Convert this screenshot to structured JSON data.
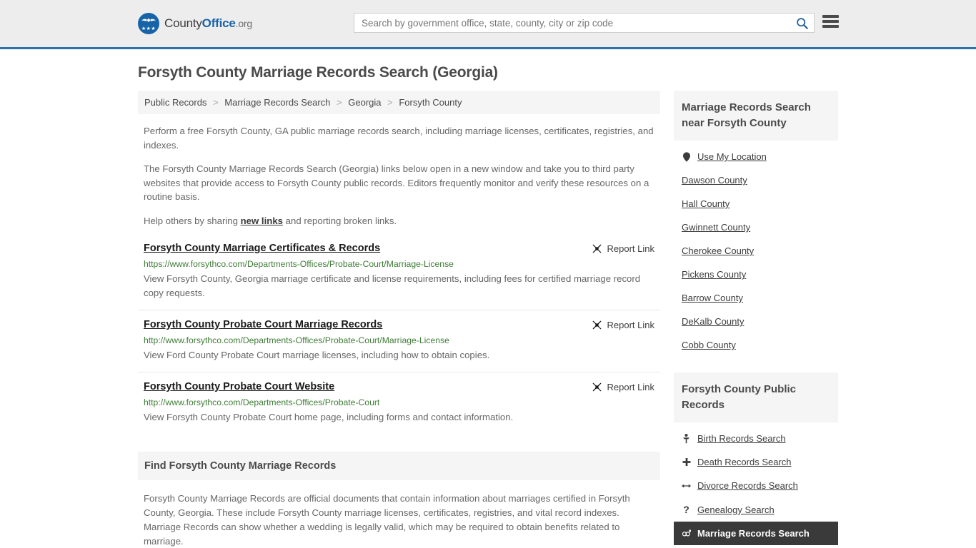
{
  "header": {
    "logo_text_1": "County",
    "logo_text_2": "Office",
    "logo_text_3": ".org",
    "logo_icon": "eagle-seal-icon",
    "search_placeholder": "Search by government office, state, county, city or zip code",
    "search_value": "",
    "search_icon": "search-icon",
    "menu_icon": "hamburger-menu-icon"
  },
  "page": {
    "title": "Forsyth County Marriage Records Search (Georgia)"
  },
  "breadcrumb": {
    "items": [
      "Public Records",
      "Marriage Records Search",
      "Georgia",
      "Forsyth County"
    ],
    "separator": ">"
  },
  "intro": {
    "p1": "Perform a free Forsyth County, GA public marriage records search, including marriage licenses, certificates, registries, and indexes.",
    "p2": "The Forsyth County Marriage Records Search (Georgia) links below open in a new window and take you to third party websites that provide access to Forsyth County public records. Editors frequently monitor and verify these resources on a routine basis.",
    "p3_before": "Help others by sharing ",
    "p3_link": "new links",
    "p3_after": " and reporting broken links."
  },
  "report_link_label": "Report Link",
  "report_link_icon": "broken-link-icon",
  "results": [
    {
      "title": "Forsyth County Marriage Certificates & Records",
      "url": "https://www.forsythco.com/Departments-Offices/Probate-Court/Marriage-License",
      "description": "View Forsyth County, Georgia marriage certificate and license requirements, including fees for certified marriage record copy requests."
    },
    {
      "title": "Forsyth County Probate Court Marriage Records",
      "url": "http://www.forsythco.com/Departments-Offices/Probate-Court/Marriage-License",
      "description": "View Ford County Probate Court marriage licenses, including how to obtain copies."
    },
    {
      "title": "Forsyth County Probate Court Website",
      "url": "http://www.forsythco.com/Departments-Offices/Probate-Court",
      "description": "View Forsyth County Probate Court home page, including forms and contact information."
    }
  ],
  "find_section": {
    "heading": "Find Forsyth County Marriage Records",
    "body": "Forsyth County Marriage Records are official documents that contain information about marriages certified in Forsyth County, Georgia. These include Forsyth County marriage licenses, certificates, registries, and vital record indexes. Marriage Records can show whether a wedding is legally valid, which may be required to obtain benefits related to marriage."
  },
  "sidebar": {
    "nearby_panel": {
      "heading": "Marriage Records Search near Forsyth County",
      "items": [
        {
          "label": "Use My Location",
          "icon": "map-pin-icon",
          "has_icon": true
        },
        {
          "label": "Dawson County",
          "icon": "",
          "has_icon": false
        },
        {
          "label": "Hall County",
          "icon": "",
          "has_icon": false
        },
        {
          "label": "Gwinnett County",
          "icon": "",
          "has_icon": false
        },
        {
          "label": "Cherokee County",
          "icon": "",
          "has_icon": false
        },
        {
          "label": "Pickens County",
          "icon": "",
          "has_icon": false
        },
        {
          "label": "Barrow County",
          "icon": "",
          "has_icon": false
        },
        {
          "label": "DeKalb County",
          "icon": "",
          "has_icon": false
        },
        {
          "label": "Cobb County",
          "icon": "",
          "has_icon": false
        }
      ]
    },
    "public_records_panel": {
      "heading": "Forsyth County Public Records",
      "items": [
        {
          "label": "Birth Records Search",
          "icon": "baby-icon",
          "glyph": "Ɣ",
          "active": false
        },
        {
          "label": "Death Records Search",
          "icon": "cross-icon",
          "glyph": "✚",
          "active": false
        },
        {
          "label": "Divorce Records Search",
          "icon": "left-right-arrow-icon",
          "glyph": "↔",
          "active": false
        },
        {
          "label": "Genealogy Search",
          "icon": "question-mark-icon",
          "glyph": "?",
          "active": false
        },
        {
          "label": "Marriage Records Search",
          "icon": "gender-symbols-icon",
          "glyph": "⚥",
          "active": true
        }
      ]
    }
  },
  "colors": {
    "header_bg": "#ededed",
    "header_border": "#2e72ab",
    "brand_blue": "#1763a8",
    "panel_bg": "#f5f5f5",
    "url_green": "#3f7d36",
    "active_bg": "#3a3a3a",
    "body_text": "#676767"
  }
}
